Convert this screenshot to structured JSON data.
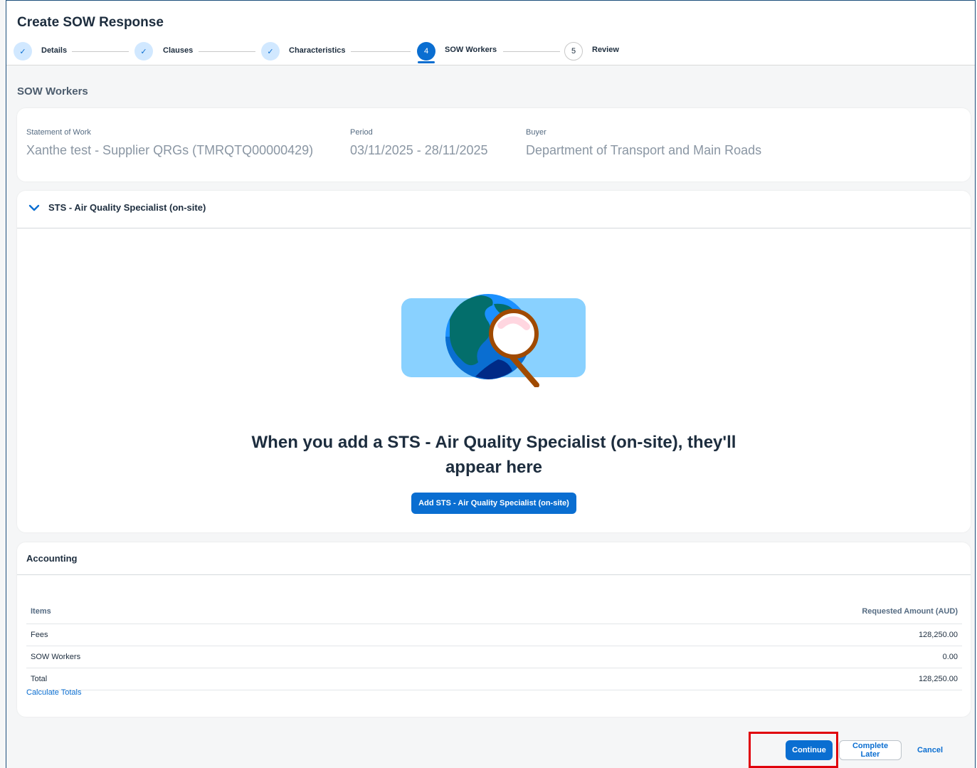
{
  "page": {
    "title": "Create SOW Response",
    "section_title": "SOW Workers"
  },
  "steps": [
    {
      "marker": "✓",
      "label": "Details",
      "state": "done"
    },
    {
      "marker": "✓",
      "label": "Clauses",
      "state": "done"
    },
    {
      "marker": "✓",
      "label": "Characteristics",
      "state": "done"
    },
    {
      "marker": "4",
      "label": "SOW Workers",
      "state": "active"
    },
    {
      "marker": "5",
      "label": "Review",
      "state": "todo"
    }
  ],
  "info": {
    "sow_label": "Statement of Work",
    "sow_value": "Xanthe test - Supplier QRGs (TMRQTQ00000429)",
    "period_label": "Period",
    "period_value": "03/11/2025 - 28/11/2025",
    "buyer_label": "Buyer",
    "buyer_value": "Department of Transport and Main Roads"
  },
  "worker_panel": {
    "title": "STS - Air Quality Specialist (on-site)",
    "empty_text": "When you add a STS - Air Quality Specialist (on-site), they'll appear here",
    "add_button": "Add STS - Air Quality Specialist (on-site)"
  },
  "accounting": {
    "title": "Accounting",
    "col_items": "Items",
    "col_amount": "Requested Amount (AUD)",
    "rows": [
      {
        "item": "Fees",
        "amount": "128,250.00"
      },
      {
        "item": "SOW Workers",
        "amount": "0.00"
      },
      {
        "item": "Total",
        "amount": "128,250.00"
      }
    ],
    "calc_link": "Calculate Totals"
  },
  "footer": {
    "continue": "Continue",
    "complete_later": "Complete Later",
    "cancel": "Cancel"
  },
  "colors": {
    "accent": "#0a6ed1",
    "highlight": "#e0000b"
  }
}
